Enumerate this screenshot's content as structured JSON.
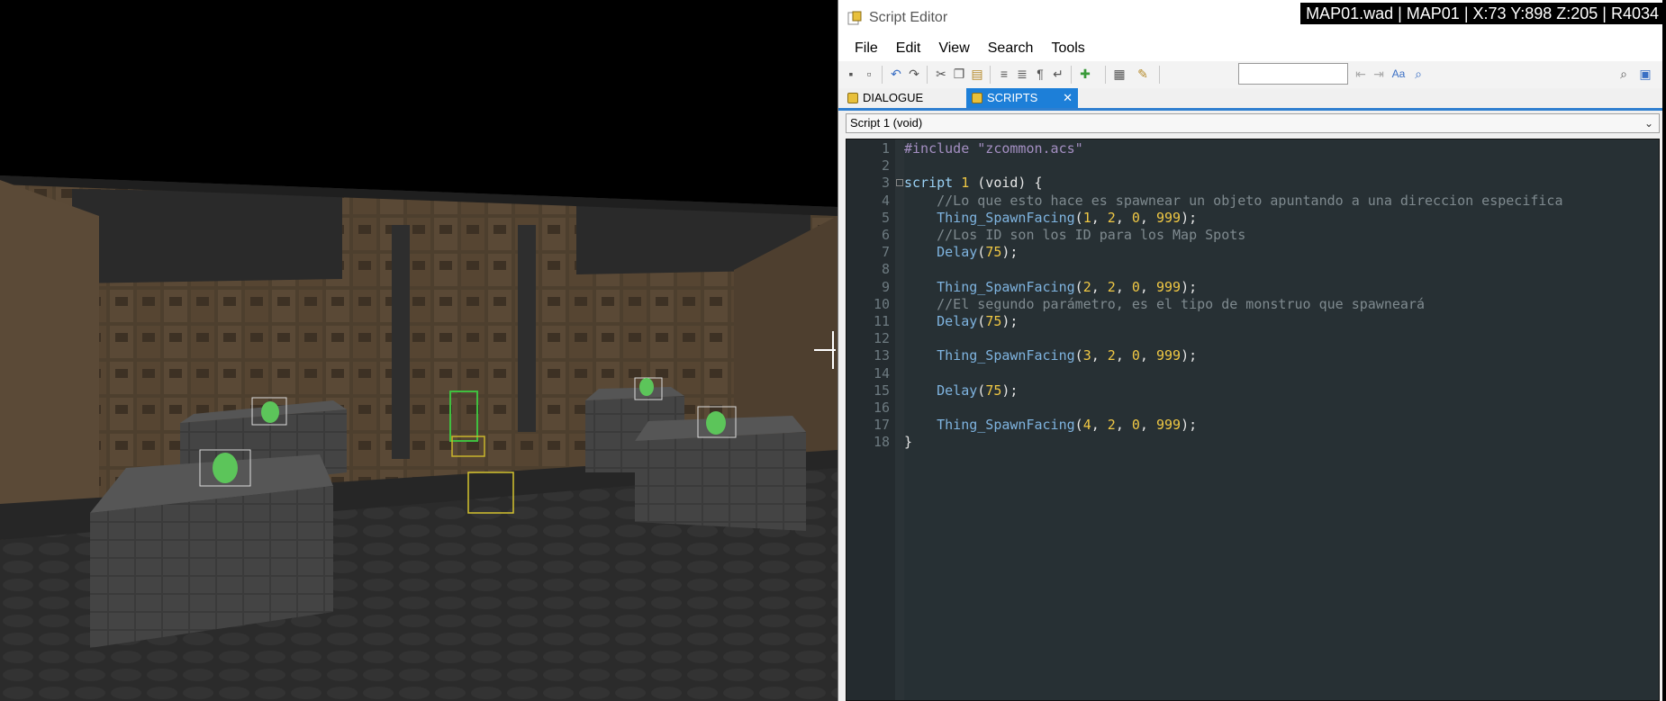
{
  "status_overlay": "MAP01.wad | MAP01 | X:73 Y:898 Z:205 | R4034",
  "editor": {
    "title": "Script Editor",
    "menu": [
      "File",
      "Edit",
      "View",
      "Search",
      "Tools"
    ],
    "search_value": "",
    "tabs": [
      {
        "label": "DIALOGUE",
        "active": false
      },
      {
        "label": "SCRIPTS",
        "active": true,
        "close": "✕"
      }
    ],
    "script_select": "Script 1 (void)",
    "code_lines": [
      {
        "n": "1",
        "tokens": [
          {
            "c": "c-pre",
            "t": "#include \"zcommon.acs\""
          }
        ]
      },
      {
        "n": "2",
        "tokens": []
      },
      {
        "n": "3",
        "tokens": [
          {
            "c": "c-kw",
            "t": "script "
          },
          {
            "c": "c-num",
            "t": "1"
          },
          {
            "c": "c-def",
            "t": " (void) {"
          }
        ]
      },
      {
        "n": "4",
        "tokens": [
          {
            "c": "c-cm",
            "t": "    //Lo que esto hace es spawnear un objeto apuntando a una direccion especifica"
          }
        ]
      },
      {
        "n": "5",
        "tokens": [
          {
            "c": "c-fn",
            "t": "    Thing_SpawnFacing"
          },
          {
            "c": "c-def",
            "t": "("
          },
          {
            "c": "c-num",
            "t": "1"
          },
          {
            "c": "c-def",
            "t": ", "
          },
          {
            "c": "c-num",
            "t": "2"
          },
          {
            "c": "c-def",
            "t": ", "
          },
          {
            "c": "c-num",
            "t": "0"
          },
          {
            "c": "c-def",
            "t": ", "
          },
          {
            "c": "c-num",
            "t": "999"
          },
          {
            "c": "c-def",
            "t": ");"
          }
        ]
      },
      {
        "n": "6",
        "tokens": [
          {
            "c": "c-cm",
            "t": "    //Los ID son los ID para los Map Spots"
          }
        ]
      },
      {
        "n": "7",
        "tokens": [
          {
            "c": "c-fn",
            "t": "    Delay"
          },
          {
            "c": "c-def",
            "t": "("
          },
          {
            "c": "c-num",
            "t": "75"
          },
          {
            "c": "c-def",
            "t": ");"
          }
        ]
      },
      {
        "n": "8",
        "tokens": []
      },
      {
        "n": "9",
        "tokens": [
          {
            "c": "c-fn",
            "t": "    Thing_SpawnFacing"
          },
          {
            "c": "c-def",
            "t": "("
          },
          {
            "c": "c-num",
            "t": "2"
          },
          {
            "c": "c-def",
            "t": ", "
          },
          {
            "c": "c-num",
            "t": "2"
          },
          {
            "c": "c-def",
            "t": ", "
          },
          {
            "c": "c-num",
            "t": "0"
          },
          {
            "c": "c-def",
            "t": ", "
          },
          {
            "c": "c-num",
            "t": "999"
          },
          {
            "c": "c-def",
            "t": ");"
          }
        ]
      },
      {
        "n": "10",
        "tokens": [
          {
            "c": "c-cm",
            "t": "    //El segundo parámetro, es el tipo de monstruo que spawneará"
          }
        ]
      },
      {
        "n": "11",
        "tokens": [
          {
            "c": "c-fn",
            "t": "    Delay"
          },
          {
            "c": "c-def",
            "t": "("
          },
          {
            "c": "c-num",
            "t": "75"
          },
          {
            "c": "c-def",
            "t": ");"
          }
        ]
      },
      {
        "n": "12",
        "tokens": []
      },
      {
        "n": "13",
        "tokens": [
          {
            "c": "c-fn",
            "t": "    Thing_SpawnFacing"
          },
          {
            "c": "c-def",
            "t": "("
          },
          {
            "c": "c-num",
            "t": "3"
          },
          {
            "c": "c-def",
            "t": ", "
          },
          {
            "c": "c-num",
            "t": "2"
          },
          {
            "c": "c-def",
            "t": ", "
          },
          {
            "c": "c-num",
            "t": "0"
          },
          {
            "c": "c-def",
            "t": ", "
          },
          {
            "c": "c-num",
            "t": "999"
          },
          {
            "c": "c-def",
            "t": ");"
          }
        ]
      },
      {
        "n": "14",
        "tokens": []
      },
      {
        "n": "15",
        "tokens": [
          {
            "c": "c-fn",
            "t": "    Delay"
          },
          {
            "c": "c-def",
            "t": "("
          },
          {
            "c": "c-num",
            "t": "75"
          },
          {
            "c": "c-def",
            "t": ");"
          }
        ]
      },
      {
        "n": "16",
        "tokens": []
      },
      {
        "n": "17",
        "tokens": [
          {
            "c": "c-fn",
            "t": "    Thing_SpawnFacing"
          },
          {
            "c": "c-def",
            "t": "("
          },
          {
            "c": "c-num",
            "t": "4"
          },
          {
            "c": "c-def",
            "t": ", "
          },
          {
            "c": "c-num",
            "t": "2"
          },
          {
            "c": "c-def",
            "t": ", "
          },
          {
            "c": "c-num",
            "t": "0"
          },
          {
            "c": "c-def",
            "t": ", "
          },
          {
            "c": "c-num",
            "t": "999"
          },
          {
            "c": "c-def",
            "t": ");"
          }
        ]
      },
      {
        "n": "18",
        "tokens": [
          {
            "c": "c-def",
            "t": "}"
          }
        ]
      }
    ],
    "toolbar_icons": [
      "save-icon",
      "save-all-icon",
      "undo-icon",
      "redo-icon",
      "cut-icon",
      "copy-icon",
      "paste-icon",
      "indent-icon",
      "unindent-icon",
      "paragraph-icon",
      "wrap-icon",
      "plugin-icon",
      "snippet-icon",
      "compile-icon",
      "find-previous-icon",
      "find-next-icon",
      "match-case-icon",
      "replace-icon",
      "search-icon",
      "help-icon"
    ]
  },
  "colors": {
    "tab_active": "#1d7fd8",
    "code_bg": "#273034",
    "number": "#f0c844",
    "comment": "#7f8a8f"
  }
}
